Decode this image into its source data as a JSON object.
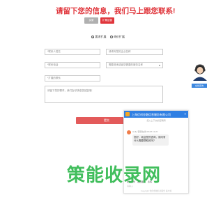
{
  "heading": "请留下您的信息，我们马上跟您联系!",
  "tabs": [
    "买家",
    "扩展运营"
  ],
  "radios": {
    "options": [
      "要求扩展",
      "询价扩展"
    ]
  },
  "form": {
    "name_placeholder": "*联系人姓名",
    "company_placeholder": "请填写您的企业名称",
    "phone_placeholder": "*联系电话",
    "service_placeholder": "需要咨询或者您需要的服务名称",
    "wechat_placeholder": "*扩展的联系",
    "message_placeholder": "请留下您的需求，我们会尽快给您回复哦！",
    "submit_label": "提交"
  },
  "side": {
    "online_label": "在线咨询"
  },
  "chat": {
    "title": "上海优创金融信息服务有限公司",
    "close_symbol": "×",
    "subtitle": "接入上下文的互联网",
    "agent_meta": "Holly 客服在线 08-08 13:20",
    "message": "您好，欢迎您的咨询，请问有什么需要帮助的吗？",
    "toolbar": [
      "发送文件",
      "发送图片",
      "表情"
    ],
    "input_hint": "请输入",
    "footer": "Copyright 优创金融信息服务 客户端"
  },
  "watermark": "策能收录网",
  "colors": {
    "brand_red": "#e0353b",
    "chat_blue": "#2f7fe3",
    "watermark_green": "#2db84b"
  }
}
